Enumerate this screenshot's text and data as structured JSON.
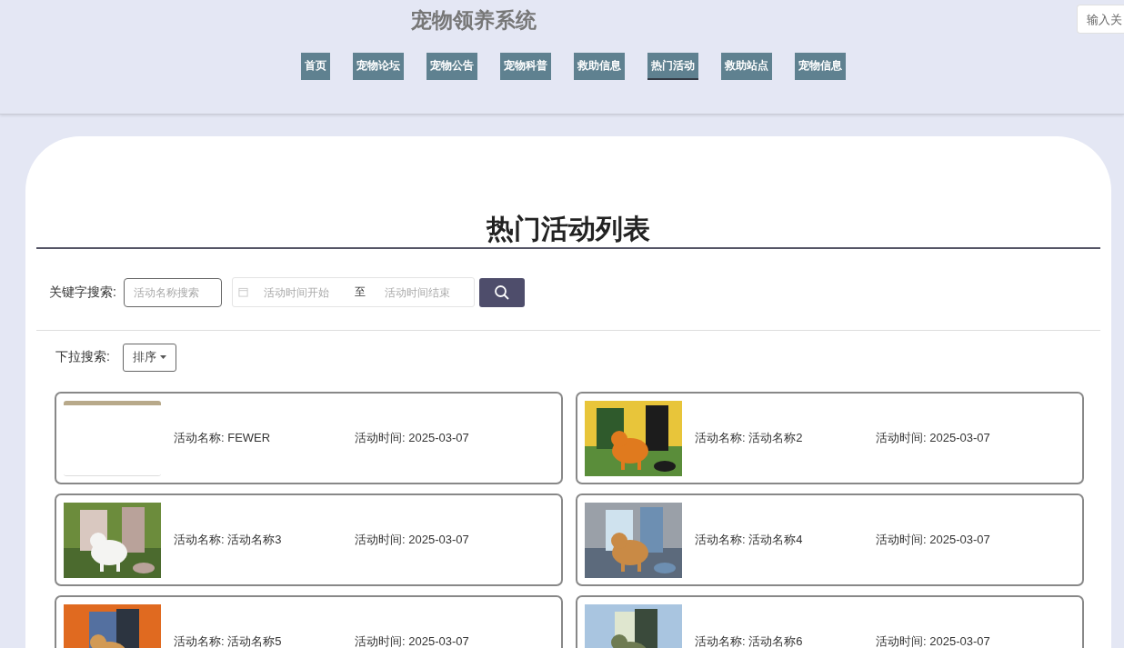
{
  "header": {
    "title": "宠物领养系统",
    "search": {
      "placeholder": "输入关"
    }
  },
  "nav": [
    {
      "label": "首页",
      "selected": false
    },
    {
      "label": "宠物论坛",
      "selected": false
    },
    {
      "label": "宠物公告",
      "selected": false
    },
    {
      "label": "宠物科普",
      "selected": false
    },
    {
      "label": "救助信息",
      "selected": false
    },
    {
      "label": "热门活动",
      "selected": true
    },
    {
      "label": "救助站点",
      "selected": false
    },
    {
      "label": "宠物信息",
      "selected": false
    }
  ],
  "page_title": "热门活动列表",
  "filters": {
    "keyword_label": "关键字搜索:",
    "keyword": {
      "placeholder": "活动名称搜索"
    },
    "date_start": {
      "placeholder": "活动时间开始"
    },
    "date_sep": "至",
    "date_end": {
      "placeholder": "活动时间结束"
    },
    "dropdown_label": "下拉搜索:",
    "sort_button": "排序"
  },
  "activities": [
    {
      "name": "活动名称: FEWER",
      "time": "活动时间: 2025-03-07"
    },
    {
      "name": "活动名称: 活动名称2",
      "time": "活动时间: 2025-03-07"
    },
    {
      "name": "活动名称: 活动名称3",
      "time": "活动时间: 2025-03-07"
    },
    {
      "name": "活动名称: 活动名称4",
      "time": "活动时间: 2025-03-07"
    },
    {
      "name": "活动名称: 活动名称5",
      "time": "活动时间: 2025-03-07"
    },
    {
      "name": "活动名称: 活动名称6",
      "time": "活动时间: 2025-03-07"
    }
  ]
}
